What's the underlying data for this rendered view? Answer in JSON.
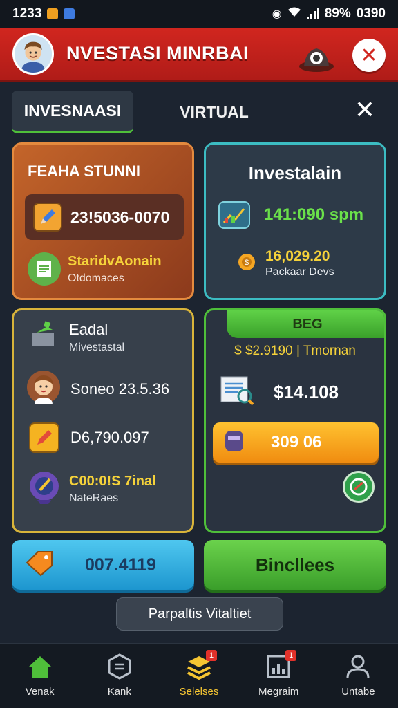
{
  "status_bar": {
    "time": "1233",
    "battery": "89%",
    "clock_right": "0390"
  },
  "header": {
    "title": "NVESTASI MINRBAI"
  },
  "tabs": {
    "active_label": "INVESNAASI",
    "inactive_label": "VIRTUAL",
    "close_symbol": "✕"
  },
  "card_orange": {
    "title": "FEAHA STUNNI",
    "amount": "23!5036-0070",
    "item_title": "StaridvAonain",
    "item_sub": "Otdomaces"
  },
  "card_teal": {
    "title": "Investalain",
    "rate": "141:090 spm",
    "amount": "16,029.20",
    "amount_sub": "Packaar Devs"
  },
  "card_yellow": {
    "row1_title": "Eadal",
    "row1_sub": "Mivestastal",
    "row2_text": "Soneo 23.5.36",
    "row3_text": "D6,790.097",
    "row4_title": "C00:0!S 7inal",
    "row4_sub": "NateRaes"
  },
  "card_green": {
    "ribbon": "BEG",
    "line": "$ $2.9190 | Tmornan",
    "amount": "$14.108",
    "button_value": "309 06"
  },
  "actions": {
    "blue_button": "007.4119",
    "green_button": "Bincllees",
    "dark_button": "Parpaltis Vitaltiet"
  },
  "bottom_nav": {
    "items": [
      {
        "label": "Venak",
        "icon": "home-icon"
      },
      {
        "label": "Kank",
        "icon": "hexagon-icon"
      },
      {
        "label": "Selelses",
        "icon": "stack-icon",
        "badge": "1"
      },
      {
        "label": "Megraim",
        "icon": "chart-icon",
        "badge": "1"
      },
      {
        "label": "Untabe",
        "icon": "user-icon"
      }
    ]
  },
  "colors": {
    "header_red": "#d1261f",
    "accent_green": "#4fbf3a",
    "accent_gold": "#f5c532",
    "teal_border": "#3cbcc2"
  }
}
